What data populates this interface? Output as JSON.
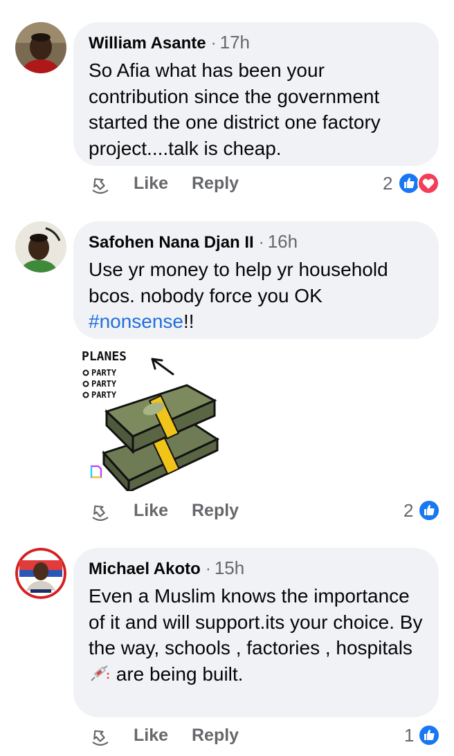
{
  "comments": [
    {
      "author": "William Asante",
      "separator": "·",
      "time": "17h",
      "text": "So Afia what has been your contribution since the government started the one district one factory project....talk is cheap.",
      "actions": {
        "like": "Like",
        "reply": "Reply"
      },
      "reactions": {
        "count": "2",
        "types": [
          "like-icon",
          "love-icon"
        ]
      }
    },
    {
      "author": "Safohen Nana Djan II",
      "separator": "·",
      "time": "16h",
      "text_parts": [
        "Use yr money to help yr household bcos. nobody force you OK ",
        "#nonsense",
        "!!"
      ],
      "sticker": {
        "title": "PLANES",
        "items": [
          "PARTY",
          "PARTY",
          "PARTY"
        ]
      },
      "actions": {
        "like": "Like",
        "reply": "Reply"
      },
      "reactions": {
        "count": "2",
        "types": [
          "like-icon"
        ]
      }
    },
    {
      "author": "Michael Akoto",
      "separator": "·",
      "time": "15h",
      "text_before_emoji": "Even a Muslim knows the importance of it and will support.its your choice. By the way, schools , factories , hospitals ",
      "text_after_emoji": " are being built.",
      "emoji": "syringe",
      "actions": {
        "like": "Like",
        "reply": "Reply"
      },
      "reactions": {
        "count": "1",
        "types": [
          "like-icon"
        ]
      }
    }
  ],
  "colors": {
    "bubble": "#f0f2f5",
    "secondary_text": "#65676b",
    "link": "#216fdb",
    "like_blue": "#1877f2",
    "love_red": "#f33e58"
  }
}
